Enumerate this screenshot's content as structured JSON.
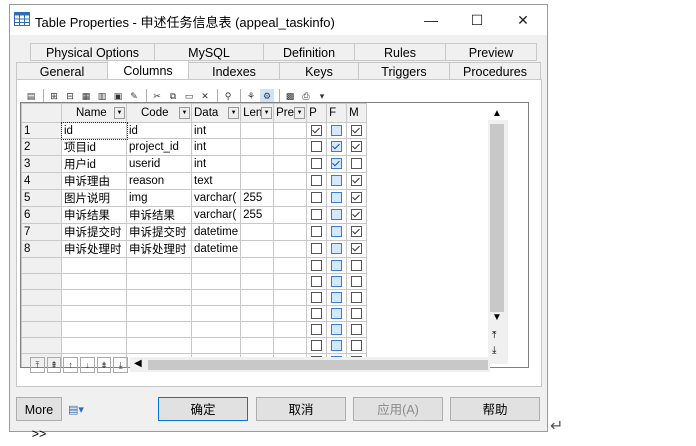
{
  "window": {
    "title": "Table Properties - 申述任务信息表 (appeal_taskinfo)",
    "minimize_glyph": "—",
    "maximize_glyph": "☐",
    "close_glyph": "✕"
  },
  "tabs_row1": [
    "Physical Options",
    "MySQL",
    "Definition",
    "Rules",
    "Preview"
  ],
  "tabs_row2": [
    "General",
    "Columns",
    "Indexes",
    "Keys",
    "Triggers",
    "Procedures"
  ],
  "active_tab": "Columns",
  "grid": {
    "headers": [
      "Name",
      "Code",
      "Data",
      "Len",
      "Pre",
      "P",
      "F",
      "M"
    ],
    "rows": [
      {
        "num": "1",
        "name": "id",
        "code": "id",
        "data": "int",
        "len": "",
        "pre": "",
        "p": true,
        "f": false,
        "m": true
      },
      {
        "num": "2",
        "name": "项目id",
        "code": "project_id",
        "data": "int",
        "len": "",
        "pre": "",
        "p": false,
        "f": true,
        "m": true
      },
      {
        "num": "3",
        "name": "用户id",
        "code": "userid",
        "data": "int",
        "len": "",
        "pre": "",
        "p": false,
        "f": true,
        "m": false
      },
      {
        "num": "4",
        "name": "申诉理由",
        "code": "reason",
        "data": "text",
        "len": "",
        "pre": "",
        "p": false,
        "f": false,
        "m": true
      },
      {
        "num": "5",
        "name": "图片说明",
        "code": "img",
        "data": "varchar(",
        "len": "255",
        "pre": "",
        "p": false,
        "f": false,
        "m": true
      },
      {
        "num": "6",
        "name": "申诉结果",
        "code": "申诉结果",
        "data": "varchar(",
        "len": "255",
        "pre": "",
        "p": false,
        "f": false,
        "m": true
      },
      {
        "num": "7",
        "name": "申诉提交时",
        "code": "申诉提交时",
        "data": "datetime",
        "len": "",
        "pre": "",
        "p": false,
        "f": false,
        "m": true
      },
      {
        "num": "8",
        "name": "申诉处理时",
        "code": "申诉处理时",
        "data": "datetime",
        "len": "",
        "pre": "",
        "p": false,
        "f": false,
        "m": true
      }
    ],
    "empty_rows": 7
  },
  "buttons": {
    "more": "More >>",
    "ok": "确定",
    "cancel": "取消",
    "apply": "应用(A)",
    "help": "帮助"
  },
  "colors": {
    "accent": "#0078d7",
    "grid_line": "#c8c8c8"
  }
}
